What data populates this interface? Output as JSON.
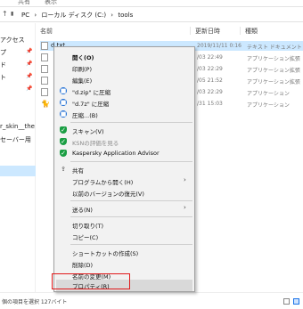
{
  "ribbon": {
    "tabs": [
      "共有",
      "表示"
    ]
  },
  "address": {
    "back": "←",
    "forward": "→",
    "up": "↑",
    "crumbs": [
      "PC",
      "›",
      "ローカル ディスク (C:)",
      "›",
      "tools"
    ]
  },
  "navpane": {
    "items": [
      "アクセス",
      "プ",
      "ド",
      "ト",
      "r_skin__the",
      "セーバー用"
    ]
  },
  "columns": {
    "name": "名前",
    "date": "更新日時",
    "type": "種類"
  },
  "files": [
    {
      "name": "d.txt",
      "date": "2019/11/11 0:16",
      "type": "テキスト ドキュメント"
    },
    {
      "name": "",
      "date": "/03 22:49",
      "type": "アプリケーション拡張"
    },
    {
      "name": "",
      "date": "/03 22:29",
      "type": "アプリケーション拡張"
    },
    {
      "name": "",
      "date": "/05 21:52",
      "type": "アプリケーション拡張"
    },
    {
      "name": "",
      "date": "/03 22:29",
      "type": "アプリケーション"
    },
    {
      "name": "",
      "date": "/31 15:03",
      "type": "アプリケーション"
    }
  ],
  "status": {
    "text": "個の項目を選択  127バイト"
  },
  "menu": {
    "open": "開く(O)",
    "print": "印刷(P)",
    "edit": "編集(E)",
    "zip": "\"d.zip\" に圧縮",
    "sevenz": "\"d.7z\" に圧縮",
    "compress": "圧縮...(B)",
    "scan": "スキャン(V)",
    "ksn": "KSNの評価を見る",
    "advisor": "Kaspersky Application Advisor",
    "share": "共有",
    "open_with": "プログラムから開く(H)",
    "restore": "以前のバージョンの復元(V)",
    "send_to": "送る(N)",
    "cut": "切り取り(T)",
    "copy": "コピー(C)",
    "shortcut": "ショートカットの作成(S)",
    "delete": "削除(D)",
    "rename": "名前の変更(M)",
    "properties": "プロパティ(R)"
  },
  "colors": {
    "highlight": "#e0191a",
    "selection": "#cce8ff",
    "kaspersky": "#1a9e43"
  }
}
